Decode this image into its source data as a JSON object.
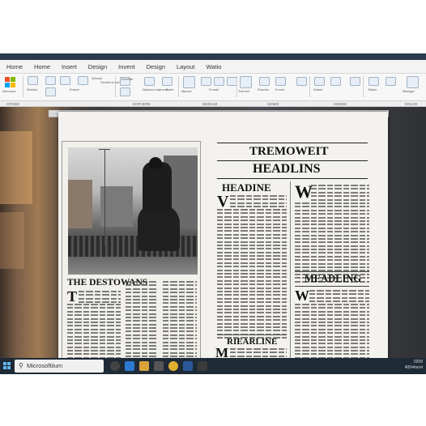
{
  "menu": {
    "items": [
      "Home",
      "Home",
      "Insert",
      "Design",
      "Invent",
      "Design",
      "Layout",
      "Watio"
    ]
  },
  "ribbon": {
    "labels": [
      "Mocrosoc",
      "Streeks",
      "Eraven",
      "Scheptr",
      "Semett oroseun",
      "Emerhte",
      "Wactoon matroom",
      "Bwire",
      "Manuel",
      "Fronde",
      "Thermer",
      "Rorurfar",
      "Fronor",
      "Dearer",
      "Bwine",
      "Mesnger"
    ],
    "groups": [
      "CROBS",
      "",
      "EOPHERE",
      "MEDIUM",
      "SOMIE",
      "MUNEE",
      "EOLOE"
    ]
  },
  "document": {
    "main_title_line1": "TREMOWEIT",
    "main_title_line2": "HEADLINS",
    "left_headline": "THE DESTOWANS",
    "left_dropcap": "T",
    "mid_headline": "HEADINE",
    "mid_dropcap": "V",
    "mid_headline2": "RIEARLINE",
    "mid_dropcap2": "M",
    "right_dropcap": "W",
    "right_headline": "MEADLING",
    "right_dropcap2": "W"
  },
  "taskbar": {
    "search_text": "Microsoftiium",
    "time": "0208",
    "date": "4054mont"
  }
}
